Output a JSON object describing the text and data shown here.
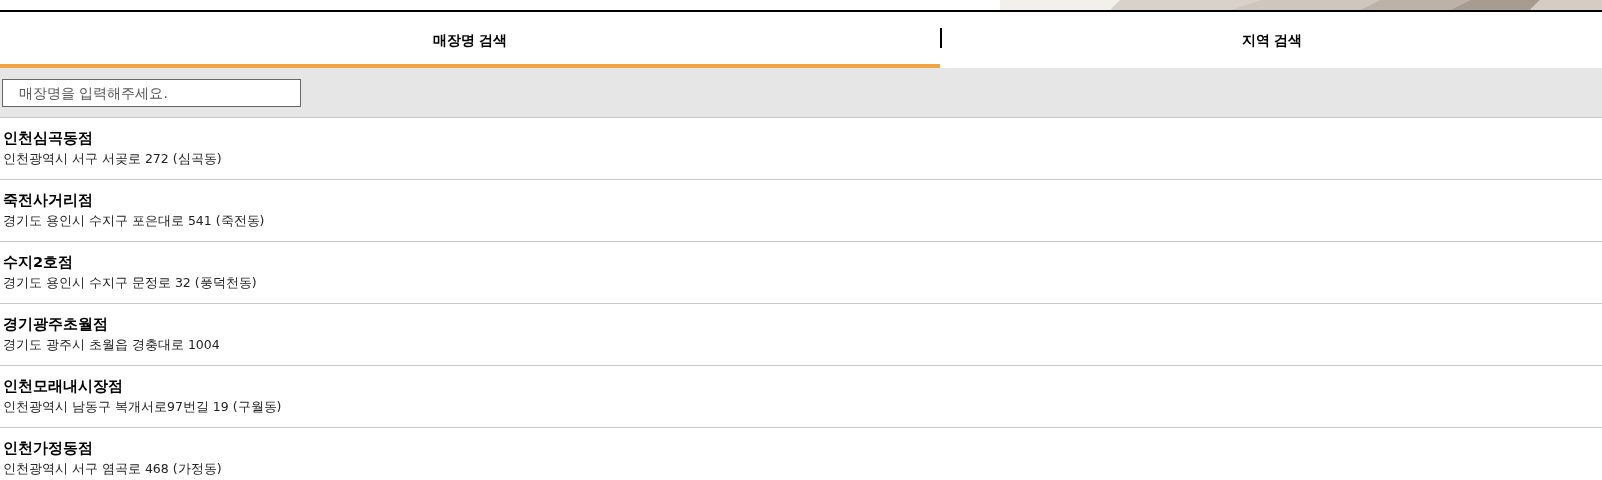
{
  "tabs": [
    {
      "label": "매장명 검색",
      "selected": true
    },
    {
      "label": "지역 검색",
      "selected": false
    }
  ],
  "search": {
    "placeholder": "매장명을 입력해주세요."
  },
  "stores": [
    {
      "name": "인천심곡동점",
      "address": "인천광역시 서구 서곶로 272 (심곡동)"
    },
    {
      "name": "죽전사거리점",
      "address": "경기도 용인시 수지구 포은대로 541 (죽전동)"
    },
    {
      "name": "수지2호점",
      "address": "경기도 용인시 수지구 문정로 32 (풍덕천동)"
    },
    {
      "name": "경기광주초월점",
      "address": "경기도 광주시 초월읍 경충대로 1004"
    },
    {
      "name": "인천모래내시장점",
      "address": "인천광역시 남동구 복개서로97번길 19 (구월동)"
    },
    {
      "name": "인천가정동점",
      "address": "인천광역시 서구 염곡로 468 (가정동)"
    }
  ]
}
